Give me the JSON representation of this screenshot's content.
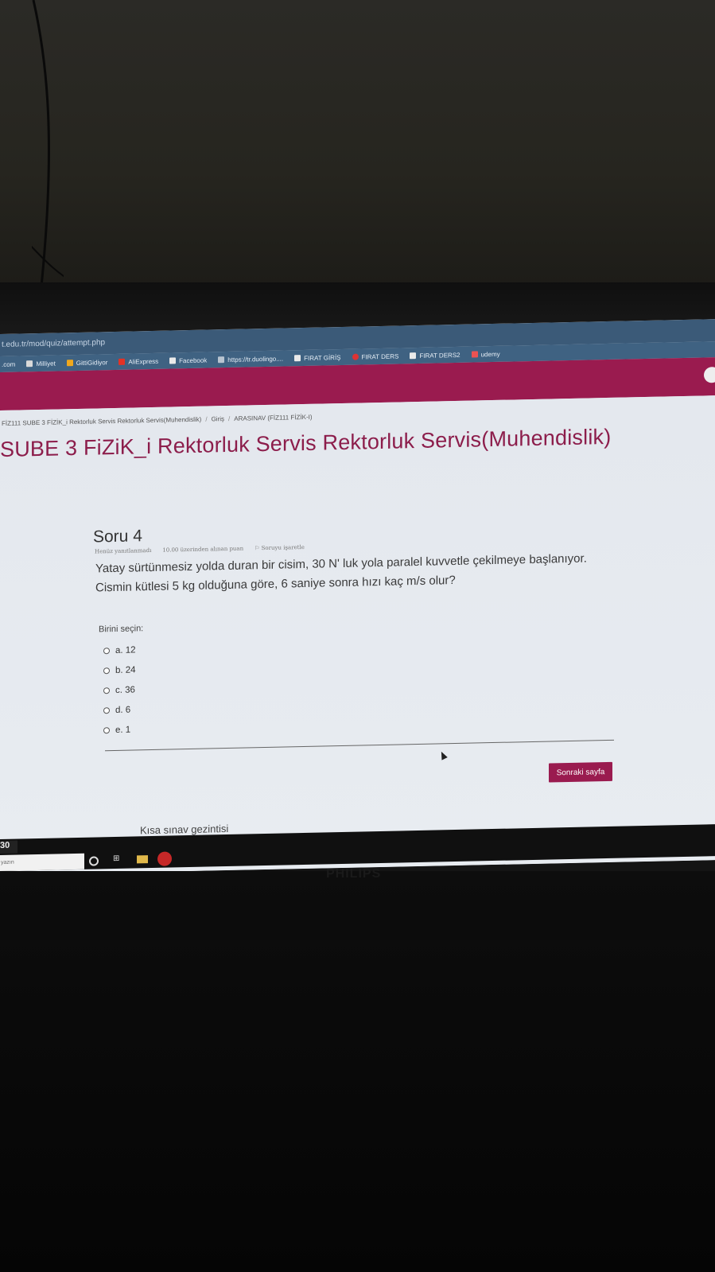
{
  "browser": {
    "url": "t.edu.tr/mod/quiz/attempt.php",
    "bookmarks": [
      {
        "label": ".com",
        "icon": "none-icon"
      },
      {
        "label": "Milliyet",
        "icon": "milliyet-icon"
      },
      {
        "label": "GittiGidiyor",
        "icon": "gittigidiyor-icon"
      },
      {
        "label": "AliExpress",
        "icon": "aliexpress-icon"
      },
      {
        "label": "Facebook",
        "icon": "page-icon"
      },
      {
        "label": "https://tr.duolingo....",
        "icon": "grid-icon"
      },
      {
        "label": "FIRAT GİRİŞ",
        "icon": "page-icon"
      },
      {
        "label": "FIRAT DERS",
        "icon": "pin-icon"
      },
      {
        "label": "FIRAT DERS2",
        "icon": "page-icon"
      },
      {
        "label": "udemy",
        "icon": "udemy-icon"
      }
    ]
  },
  "breadcrumb": {
    "course": "FİZ111 SUBE 3 FİZİK_i Rektorluk Servis Rektorluk Servis(Muhendislik)",
    "section": "Giriş",
    "quiz": "ARASINAV (FİZ111 FİZİK-I)"
  },
  "course_title": "SUBE 3 FiZiK_i Rektorluk Servis Rektorluk Servis(Muhendislik)",
  "question": {
    "heading": "Soru 4",
    "status": "Henüz yanıtlanmadı",
    "points": "10.00 üzerinden alınan puan",
    "flag": "Soruyu işaretle",
    "text": "Yatay sürtünmesiz yolda duran bir cisim, 30 N' luk yola paralel kuvvetle çekilmeye başlanıyor. Cismin kütlesi 5 kg olduğuna göre, 6 saniye sonra hızı kaç m/s olur?",
    "choose_label": "Birini seçin:",
    "options": [
      "a. 12",
      "b. 24",
      "c. 36",
      "d. 6",
      "e. 1"
    ]
  },
  "next_button": "Sonraki sayfa",
  "quiz_navigation": "Kısa sınav gezintisi",
  "taskbar": {
    "clock": "30",
    "search_placeholder": "yazın"
  },
  "monitor_brand": "PHILIPS",
  "colors": {
    "brand": "#9a1b4f",
    "address_bar": "#3b5a78"
  }
}
